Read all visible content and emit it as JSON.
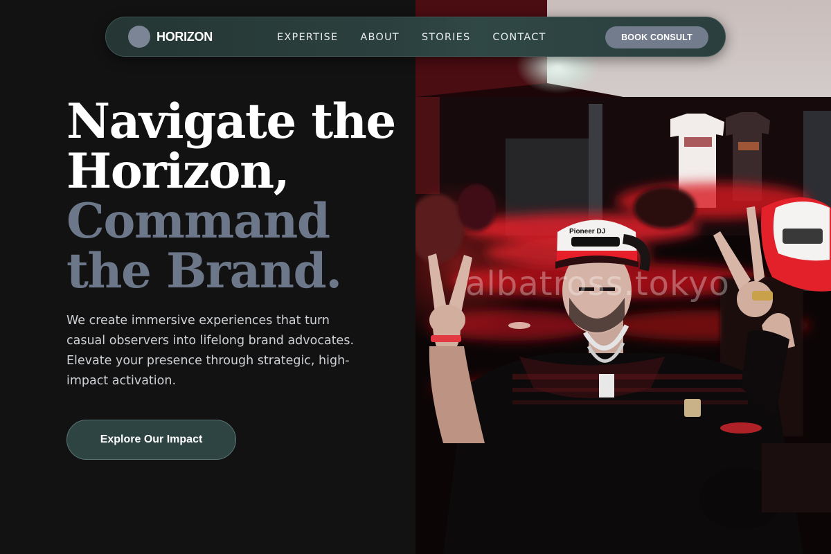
{
  "navbar": {
    "brand_name": "HORIZON",
    "links": [
      "EXPERTISE",
      "ABOUT",
      "STORIES",
      "CONTACT"
    ],
    "cta_label": "BOOK CONSULT"
  },
  "hero": {
    "title_lines": [
      "Navigate the",
      "Horizon,",
      "Command",
      "the Brand."
    ],
    "description": "We create immersive experiences that turn casual observers into lifelong brand advocates. Elevate your presence through strategic, high-impact activation.",
    "cta_label": "Explore Our Impact"
  },
  "photo": {
    "watermark": "albatross.tokyo",
    "cap_text": "Pioneer DJ"
  },
  "colors": {
    "background": "#121212",
    "navbar": "#2b403e",
    "muted_heading": "#6c7789",
    "nav_cta": "#727c8c",
    "photo_accent": "#d42026"
  }
}
